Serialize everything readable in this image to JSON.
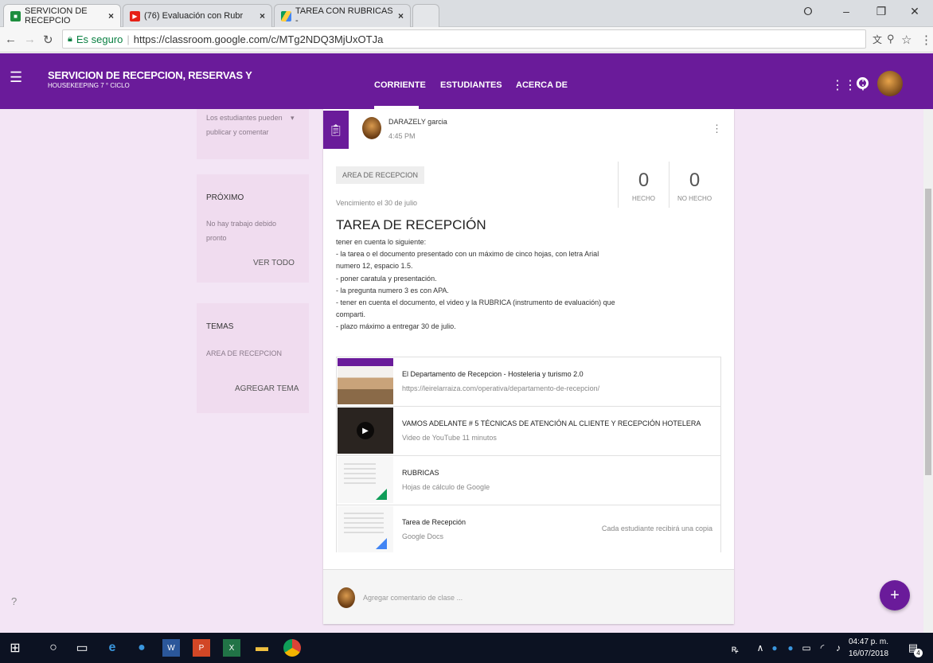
{
  "browser": {
    "tabs": [
      {
        "title": "SERVICION DE RECEPCIO",
        "icon": "classroom-icon",
        "active": true
      },
      {
        "title": "(76) Evaluación con Rubr",
        "icon": "youtube-icon",
        "active": false
      },
      {
        "title": "TAREA CON RUBRICAS -",
        "icon": "drive-icon",
        "active": false
      }
    ],
    "secure_label": "Es seguro",
    "url": "https://classroom.google.com/c/MTg2NDQ3MjUxOTJa"
  },
  "header": {
    "course_title": "SERVICION DE RECEPCION, RESERVAS Y",
    "course_subtitle": "HOUSEKEEPING 7 ° CICLO",
    "tabs": [
      "CORRIENTE",
      "ESTUDIANTES",
      "ACERCA DE"
    ],
    "color": "#6a1b9a"
  },
  "sidebar": {
    "permissions": "Los estudiantes pueden publicar y comentar",
    "permissions_line1": "Los estudiantes pueden",
    "permissions_line2": "publicar y comentar",
    "upcoming_title": "PRÓXIMO",
    "upcoming_line1": "No hay trabajo debido",
    "upcoming_line2": "pronto",
    "view_all": "VER TODO",
    "topics_title": "TEMAS",
    "topic_item": "AREA DE RECEPCION",
    "add_topic": "AGREGAR TEMA"
  },
  "post": {
    "author": "DARAZELY garcia",
    "time": "4:45 PM",
    "topic": "AREA DE RECEPCION",
    "due": "Vencimiento el 30 de julio",
    "done_count": "0",
    "done_label": "HECHO",
    "notdone_count": "0",
    "notdone_label": "NO HECHO",
    "title": "TAREA DE RECEPCIÓN",
    "description_lines": [
      "tener en cuenta lo siguiente:",
      "- la tarea o el documento presentado con un máximo de cinco hojas, con letra Arial",
      "numero 12, espacio 1.5.",
      "- poner caratula y presentación.",
      "- la pregunta numero 3 es con APA.",
      "- tener en cuenta el documento, el video y la RUBRICA (instrumento de evaluación) que",
      "comparti.",
      "- plazo máximo a entregar 30 de julio."
    ],
    "attachments": [
      {
        "title": "El Departamento de Recepcion - Hosteleria y turismo 2.0",
        "subtitle": "https://leirelarraiza.com/operativa/departamento-de-recepcion/",
        "note": ""
      },
      {
        "title": "VAMOS ADELANTE # 5 TÉCNICAS DE ATENCIÓN AL CLIENTE Y RECEPCIÓN HOTELERA",
        "subtitle": "Video de YouTube 11 minutos",
        "note": ""
      },
      {
        "title": "RUBRICAS",
        "subtitle": "Hojas de cálculo de Google",
        "note": ""
      },
      {
        "title": "Tarea de Recepción",
        "subtitle": "Google Docs",
        "note": "Cada estudiante recibirá una copia"
      }
    ],
    "comment_placeholder": "Agregar comentario de clase ..."
  },
  "taskbar": {
    "time": "04:47 p. m.",
    "date": "16/07/2018",
    "notification_count": "4"
  }
}
